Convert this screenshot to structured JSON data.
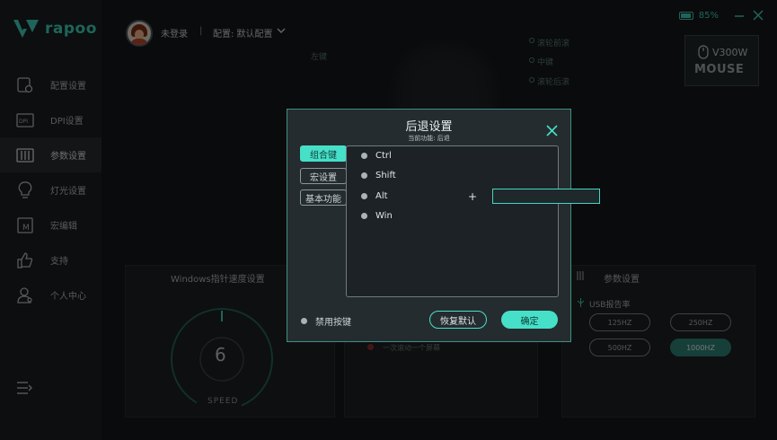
{
  "app": {
    "brand": "rapoo",
    "accent_color": "#46e0c9"
  },
  "sidebar": {
    "items": [
      {
        "label": "配置设置",
        "icon": "profile-settings-icon"
      },
      {
        "label": "DPI设置",
        "icon": "dpi-icon"
      },
      {
        "label": "参数设置",
        "icon": "parameter-icon",
        "active": true
      },
      {
        "label": "灯光设置",
        "icon": "lightbulb-icon"
      },
      {
        "label": "宏编辑",
        "icon": "macro-icon"
      },
      {
        "label": "支持",
        "icon": "thumbs-up-icon"
      },
      {
        "label": "个人中心",
        "icon": "user-icon"
      }
    ]
  },
  "topbar": {
    "login": "未登录",
    "separator": "|",
    "config": "配置: 默认配置",
    "battery": "85%"
  },
  "device": {
    "name": "V300W",
    "subtitle": "MOUSE"
  },
  "mouse_callouts": {
    "left": "左键",
    "top_right_1": "滚轮前滚",
    "top_right_2": "中键",
    "top_right_3": "滚轮后滚"
  },
  "background": {
    "windows_speed_title": "Windows指针速度设置",
    "gauge_value": "6",
    "gauge_label": "SPEED",
    "scroll_line": "一次滚动一个屏幕",
    "param_title": "参数设置",
    "usb_label": "USB报告率",
    "hz_options": [
      "125HZ",
      "250HZ",
      "500HZ",
      "1000HZ"
    ],
    "hz_selected": "1000HZ"
  },
  "dialog": {
    "title": "后退设置",
    "subtitle": "当前功能: 后退",
    "tabs": [
      "组合键",
      "宏设置",
      "基本功能"
    ],
    "active_tab": "组合键",
    "modifiers": [
      "Ctrl",
      "Shift",
      "Alt",
      "Win"
    ],
    "plus": "+",
    "key_value": "",
    "disable_label": "禁用按键",
    "reset_label": "恢复默认",
    "ok_label": "确定"
  }
}
